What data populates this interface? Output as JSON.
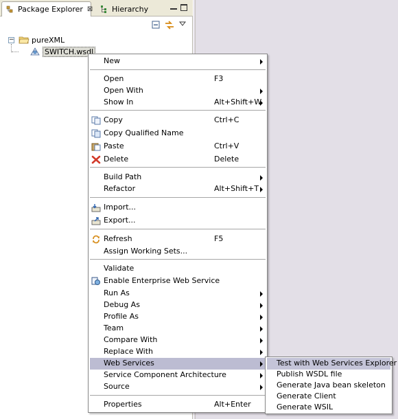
{
  "left_view": {
    "tabs": [
      {
        "label": "Package Explorer",
        "icon": "package-explorer-icon",
        "active": true,
        "close": "⊠"
      },
      {
        "label": "Hierarchy",
        "icon": "hierarchy-icon",
        "active": false
      }
    ],
    "tree": {
      "project": {
        "label": "pureXML",
        "expander": "−"
      },
      "file": {
        "label": "SWITCH.wsdl"
      }
    }
  },
  "context_menu": {
    "items": [
      {
        "label": "New",
        "submenu": true
      },
      {
        "label": "Open",
        "accel": "F3"
      },
      {
        "label": "Open With",
        "submenu": true
      },
      {
        "label": "Show In",
        "accel": "Alt+Shift+W",
        "submenu": true
      },
      {
        "label": "Copy",
        "accel": "Ctrl+C",
        "icon": "copy-icon"
      },
      {
        "label": "Copy Qualified Name",
        "icon": "copy-qualified-name-icon"
      },
      {
        "label": "Paste",
        "accel": "Ctrl+V",
        "icon": "paste-icon"
      },
      {
        "label": "Delete",
        "accel": "Delete",
        "icon": "delete-icon"
      },
      {
        "label": "Build Path",
        "submenu": true
      },
      {
        "label": "Refactor",
        "accel": "Alt+Shift+T",
        "submenu": true
      },
      {
        "label": "Import...",
        "icon": "import-icon"
      },
      {
        "label": "Export...",
        "icon": "export-icon"
      },
      {
        "label": "Refresh",
        "accel": "F5",
        "icon": "refresh-icon"
      },
      {
        "label": "Assign Working Sets..."
      },
      {
        "label": "Validate"
      },
      {
        "label": "Enable Enterprise Web Service",
        "icon": "enterprise-web-service-icon"
      },
      {
        "label": "Run As",
        "submenu": true
      },
      {
        "label": "Debug As",
        "submenu": true
      },
      {
        "label": "Profile As",
        "submenu": true
      },
      {
        "label": "Team",
        "submenu": true
      },
      {
        "label": "Compare With",
        "submenu": true
      },
      {
        "label": "Replace With",
        "submenu": true
      },
      {
        "label": "Web Services",
        "submenu": true,
        "highlighted": true
      },
      {
        "label": "Service Component Architecture",
        "submenu": true
      },
      {
        "label": "Source",
        "submenu": true
      },
      {
        "label": "Properties",
        "accel": "Alt+Enter"
      }
    ]
  },
  "web_services_submenu": {
    "items": [
      {
        "label": "Test with Web Services Explorer",
        "highlighted": true
      },
      {
        "label": "Publish WSDL file"
      },
      {
        "label": "Generate Java bean skeleton"
      },
      {
        "label": "Generate Client"
      },
      {
        "label": "Generate WSIL"
      }
    ]
  },
  "colors": {
    "menu_highlight": "#bcbcd2",
    "editor_area": "#e3dfe7",
    "tab_strip": "#ece9d8"
  }
}
